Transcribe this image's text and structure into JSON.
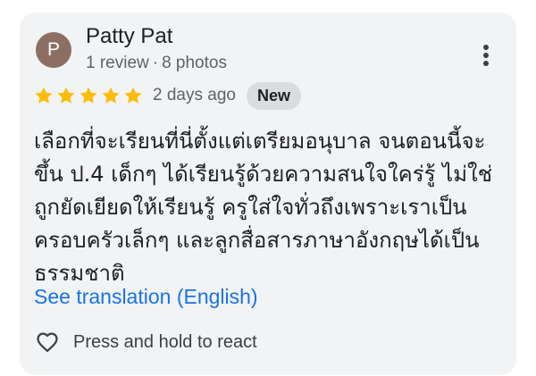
{
  "review": {
    "avatar_letter": "P",
    "avatar_color": "#8d6e63",
    "author_name": "Patty Pat",
    "review_count": "1 review",
    "separator": "·",
    "photo_count": "8 photos",
    "more_icon": "more-vert-icon",
    "rating": 5,
    "max_rating": 5,
    "star_color": "#fbbc04",
    "date": "2 days ago",
    "badge": "New",
    "text": "เลือกที่จะเรียนที่นี่ตั้งแต่เตรียมอนุบาล จนตอนนี้จะขึ้น ป.4 เด็กๆ ได้เรียนรู้ด้วยความสนใจใคร่รู้ ไม่ใช่ถูกยัดเยียดให้เรียนรู้ ครูใส่ใจทั่วถึงเพราะเราเป็นครอบครัวเล็กๆ และลูกสื่อสารภาษาอังกฤษได้เป็นธรรมชาติ",
    "translate_link": "See translation (English)",
    "link_color": "#1a73e8",
    "react_icon": "heart-outline-icon",
    "react_label": "Press and hold to react"
  }
}
